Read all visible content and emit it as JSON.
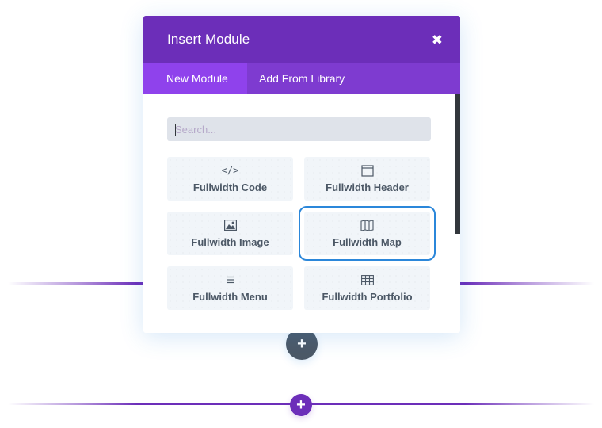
{
  "modal": {
    "title": "Insert Module",
    "close_icon": "close-icon",
    "tabs": [
      {
        "label": "New Module",
        "active": true
      },
      {
        "label": "Add From Library",
        "active": false
      }
    ],
    "search": {
      "placeholder": "Search...",
      "value": ""
    },
    "modules": [
      {
        "label": "Fullwidth Code",
        "icon": "code-icon",
        "glyph": "</>",
        "selected": false
      },
      {
        "label": "Fullwidth Header",
        "icon": "header-icon",
        "selected": false
      },
      {
        "label": "Fullwidth Image",
        "icon": "image-icon",
        "selected": false
      },
      {
        "label": "Fullwidth Map",
        "icon": "map-icon",
        "selected": true
      },
      {
        "label": "Fullwidth Menu",
        "icon": "menu-icon",
        "glyph": "≡",
        "selected": false
      },
      {
        "label": "Fullwidth Portfolio",
        "icon": "portfolio-grid-icon",
        "selected": false
      }
    ]
  },
  "builder": {
    "add_row_symbol": "+",
    "add_section_symbol": "+"
  },
  "colors": {
    "accent_purple": "#6c2eb9",
    "tab_active": "#8f42ec",
    "selected_outline": "#2b87da",
    "card_bg": "#f1f5f9",
    "text_dark": "#4c5866"
  }
}
